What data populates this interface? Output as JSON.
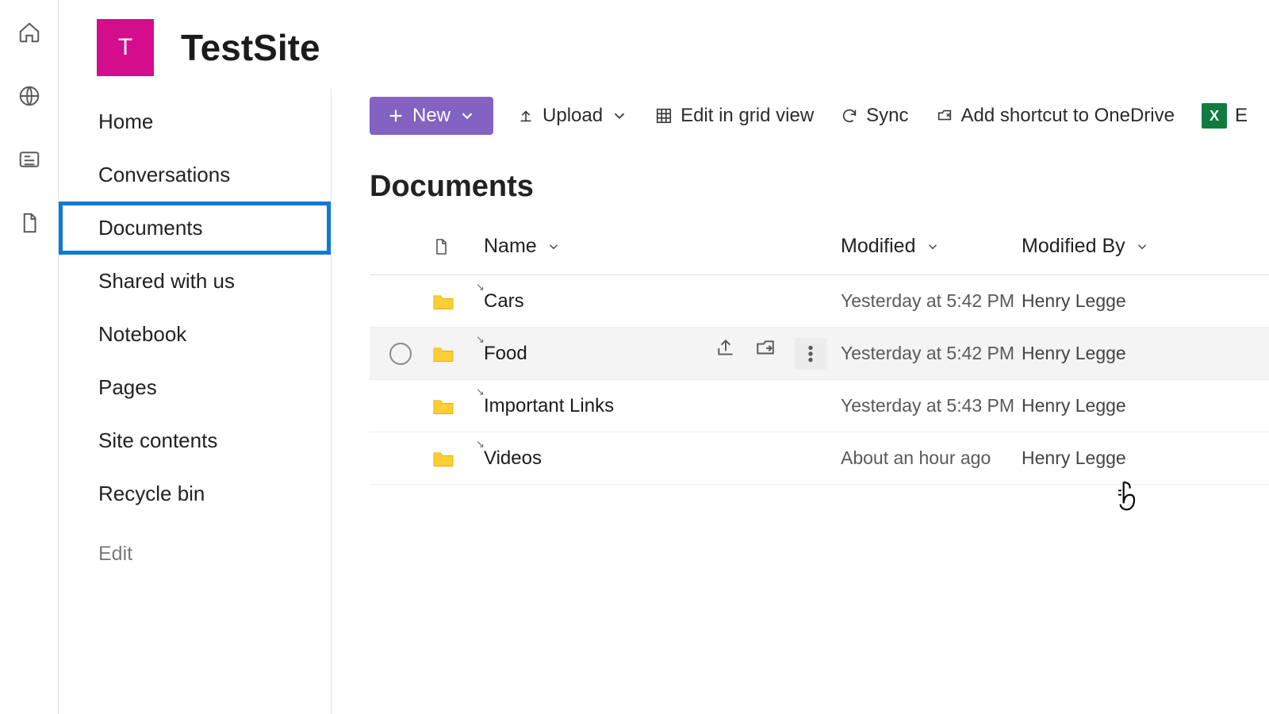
{
  "site": {
    "logo_letter": "T",
    "name": "TestSite"
  },
  "rail": {
    "items": [
      "home-icon",
      "globe-icon",
      "news-icon",
      "file-icon"
    ]
  },
  "nav": {
    "items": [
      {
        "label": "Home",
        "selected": false
      },
      {
        "label": "Conversations",
        "selected": false
      },
      {
        "label": "Documents",
        "selected": true
      },
      {
        "label": "Shared with us",
        "selected": false
      },
      {
        "label": "Notebook",
        "selected": false
      },
      {
        "label": "Pages",
        "selected": false
      },
      {
        "label": "Site contents",
        "selected": false
      },
      {
        "label": "Recycle bin",
        "selected": false
      }
    ],
    "edit_label": "Edit"
  },
  "toolbar": {
    "new_label": "New",
    "upload_label": "Upload",
    "edit_grid_label": "Edit in grid view",
    "sync_label": "Sync",
    "shortcut_label": "Add shortcut to OneDrive",
    "excel_letter": "X",
    "excel_label_partial": "E"
  },
  "library": {
    "title": "Documents",
    "columns": {
      "name": "Name",
      "modified": "Modified",
      "modified_by": "Modified By"
    }
  },
  "rows": [
    {
      "name": "Cars",
      "modified": "Yesterday at 5:42 PM",
      "modified_by": "Henry Legge",
      "hovered": false
    },
    {
      "name": "Food",
      "modified": "Yesterday at 5:42 PM",
      "modified_by": "Henry Legge",
      "hovered": true
    },
    {
      "name": "Important Links",
      "modified": "Yesterday at 5:43 PM",
      "modified_by": "Henry Legge",
      "hovered": false
    },
    {
      "name": "Videos",
      "modified": "About an hour ago",
      "modified_by": "Henry Legge",
      "hovered": false
    }
  ]
}
